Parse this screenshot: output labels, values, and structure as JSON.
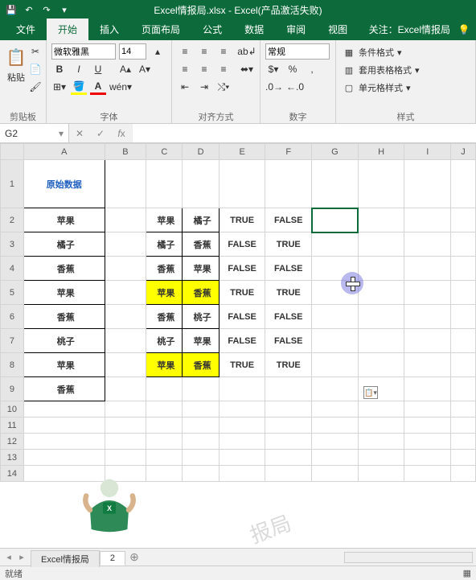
{
  "title": "Excel情报局.xlsx - Excel(产品激活失败)",
  "qat": {
    "save": "💾",
    "undo": "↶",
    "redo": "↷",
    "more": "▾"
  },
  "tabs": {
    "file": "文件",
    "home": "开始",
    "insert": "插入",
    "layout": "页面布局",
    "formula": "公式",
    "data": "数据",
    "review": "审阅",
    "view": "视图",
    "attention": "关注：Excel情报局"
  },
  "ribbon": {
    "clipboard": {
      "paste_label": "粘贴",
      "group": "剪贴板"
    },
    "font": {
      "name": "微软雅黑",
      "size": "14",
      "group": "字体"
    },
    "align": {
      "wrap": "常规",
      "group": "对齐方式"
    },
    "number": {
      "format": "常规",
      "group": "数字"
    },
    "styles": {
      "cond": "条件格式",
      "table": "套用表格格式",
      "cell": "单元格样式",
      "group": "样式"
    }
  },
  "namebox": "G2",
  "fx": "",
  "columns": [
    "A",
    "B",
    "C",
    "D",
    "E",
    "F",
    "G",
    "H",
    "I",
    "J"
  ],
  "header_a": "原始数据",
  "colA": [
    "苹果",
    "橘子",
    "香蕉",
    "苹果",
    "香蕉",
    "桃子",
    "苹果",
    "香蕉"
  ],
  "colC": [
    "苹果",
    "橘子",
    "香蕉",
    "苹果",
    "香蕉",
    "桃子",
    "苹果"
  ],
  "colD": [
    "橘子",
    "香蕉",
    "苹果",
    "香蕉",
    "桃子",
    "苹果",
    "香蕉"
  ],
  "colE": [
    "TRUE",
    "FALSE",
    "FALSE",
    "TRUE",
    "FALSE",
    "FALSE",
    "TRUE"
  ],
  "colF": [
    "FALSE",
    "TRUE",
    "FALSE",
    "TRUE",
    "FALSE",
    "FALSE",
    "TRUE"
  ],
  "highlight_rows": [
    3,
    6
  ],
  "sheets": {
    "s1": "Excel情报局",
    "s2": "2"
  },
  "status": "就绪",
  "watermark": "报局"
}
